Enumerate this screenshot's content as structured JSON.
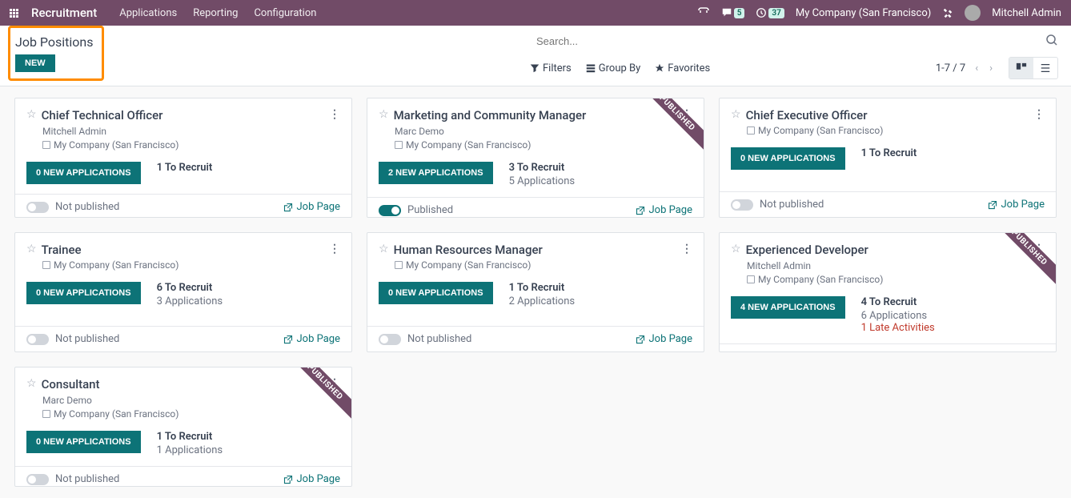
{
  "topbar": {
    "app_title": "Recruitment",
    "menu": [
      "Applications",
      "Reporting",
      "Configuration"
    ],
    "chat_badge": "5",
    "clock_badge": "37",
    "company": "My Company (San Francisco)",
    "user": "Mitchell Admin"
  },
  "subheader": {
    "title": "Job Positions",
    "new_btn": "NEW",
    "search_placeholder": "Search...",
    "filters": "Filters",
    "group_by": "Group By",
    "favorites": "Favorites",
    "pager": "1-7 / 7"
  },
  "labels": {
    "published_ribbon": "PUBLISHED",
    "job_page": "Job Page",
    "not_published": "Not published",
    "published": "Published"
  },
  "cards": [
    {
      "title": "Chief Technical Officer",
      "subtitle": "Mitchell Admin",
      "company": "My Company (San Francisco)",
      "app_btn": "0 NEW APPLICATIONS",
      "recruit": "1 To Recruit",
      "apps": "",
      "late": "",
      "published": false,
      "ribbon": false
    },
    {
      "title": "Marketing and Community Manager",
      "subtitle": "Marc Demo",
      "company": "My Company (San Francisco)",
      "app_btn": "2 NEW APPLICATIONS",
      "recruit": "3 To Recruit",
      "apps": "5 Applications",
      "late": "",
      "published": true,
      "ribbon": true
    },
    {
      "title": "Chief Executive Officer",
      "subtitle": "",
      "company": "My Company (San Francisco)",
      "app_btn": "0 NEW APPLICATIONS",
      "recruit": "1 To Recruit",
      "apps": "",
      "late": "",
      "published": false,
      "ribbon": false
    },
    {
      "title": "Trainee",
      "subtitle": "",
      "company": "My Company (San Francisco)",
      "app_btn": "0 NEW APPLICATIONS",
      "recruit": "6 To Recruit",
      "apps": "3 Applications",
      "late": "",
      "published": false,
      "ribbon": false
    },
    {
      "title": "Human Resources Manager",
      "subtitle": "",
      "company": "My Company (San Francisco)",
      "app_btn": "0 NEW APPLICATIONS",
      "recruit": "1 To Recruit",
      "apps": "2 Applications",
      "late": "",
      "published": false,
      "ribbon": false
    },
    {
      "title": "Experienced Developer",
      "subtitle": "Mitchell Admin",
      "company": "My Company (San Francisco)",
      "app_btn": "4 NEW APPLICATIONS",
      "recruit": "4 To Recruit",
      "apps": "6 Applications",
      "late": "1 Late Activities",
      "published": true,
      "ribbon": true
    },
    {
      "title": "Consultant",
      "subtitle": "Marc Demo",
      "company": "My Company (San Francisco)",
      "app_btn": "0 NEW APPLICATIONS",
      "recruit": "1 To Recruit",
      "apps": "1 Applications",
      "late": "",
      "published": false,
      "ribbon": true
    }
  ]
}
